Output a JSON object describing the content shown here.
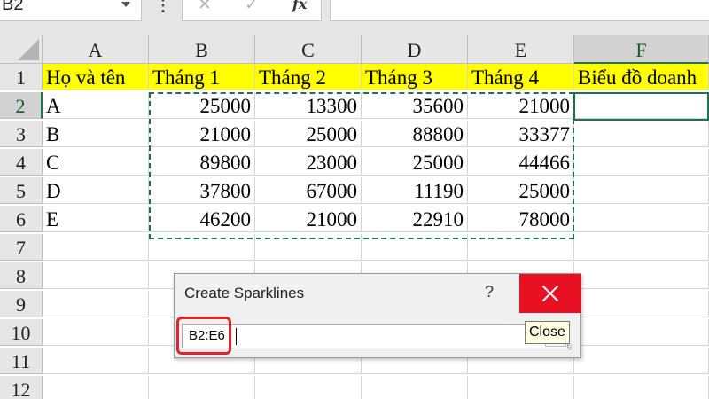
{
  "formula_bar": {
    "name_box": "B2",
    "dots": "⋮",
    "cancel_glyph": "✕",
    "enter_glyph": "✓",
    "function_label": "fx",
    "formula": ""
  },
  "sheet": {
    "columns": [
      "A",
      "B",
      "C",
      "D",
      "E",
      "F"
    ],
    "rows": [
      "1",
      "2",
      "3",
      "4",
      "5",
      "6",
      "7",
      "8",
      "9",
      "10",
      "11",
      "12"
    ],
    "header_row": [
      "Họ và tên",
      "Tháng 1",
      "Tháng 2",
      "Tháng 3",
      "Tháng 4",
      "Biểu đồ doanh"
    ],
    "data": [
      [
        "A",
        "25000",
        "13300",
        "35600",
        "21000"
      ],
      [
        "B",
        "21000",
        "25000",
        "88800",
        "33377"
      ],
      [
        "C",
        "89800",
        "23000",
        "25000",
        "44466"
      ],
      [
        "D",
        "37800",
        "67000",
        "11190",
        "25000"
      ],
      [
        "E",
        "46200",
        "21000",
        "22910",
        "78000"
      ]
    ],
    "active_cell": "B2",
    "highlight_fill": "#ffff00",
    "accent": "#217346"
  },
  "dialog": {
    "title": "Create Sparklines",
    "help": "?",
    "data_range": "B2:E6",
    "tooltip": "Close"
  },
  "icons": {
    "close": "close-icon",
    "collapse": "range-collapse-icon",
    "name_box_dropdown": "chevron-down-icon",
    "select_all": "select-all-icon",
    "function": "function-icon"
  }
}
